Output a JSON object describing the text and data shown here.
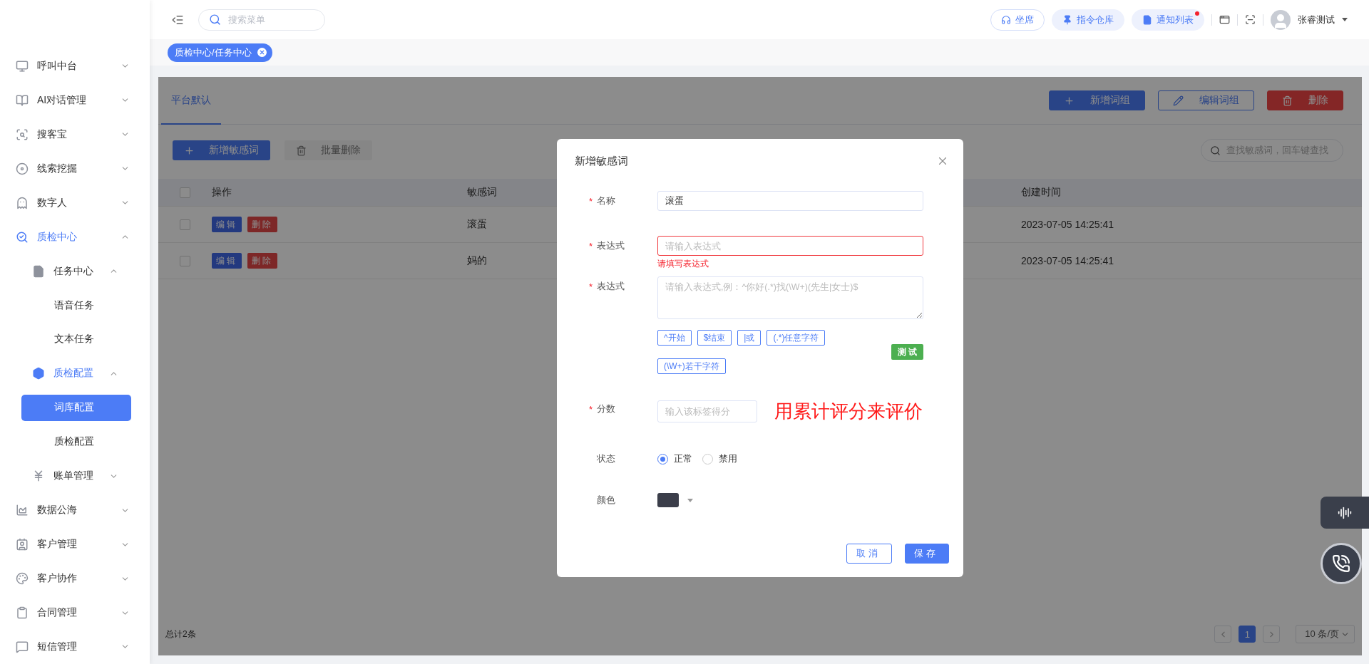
{
  "sidebar": {
    "items": [
      {
        "label": "呼叫中台",
        "expanded": false
      },
      {
        "label": "AI对话管理",
        "expanded": false
      },
      {
        "label": "搜客宝",
        "expanded": false
      },
      {
        "label": "线索挖掘",
        "expanded": false
      },
      {
        "label": "数字人",
        "expanded": false
      },
      {
        "label": "质检中心",
        "expanded": true,
        "children": [
          {
            "label": "任务中心",
            "expanded": true,
            "children": [
              {
                "label": "语音任务",
                "selected": false
              },
              {
                "label": "文本任务",
                "selected": false
              }
            ]
          },
          {
            "label": "质检配置",
            "expanded": true,
            "children": [
              {
                "label": "词库配置",
                "selected": true
              },
              {
                "label": "质检配置",
                "selected": false
              }
            ]
          },
          {
            "label": "账单管理",
            "expanded": false
          }
        ]
      },
      {
        "label": "数据公海",
        "expanded": false
      },
      {
        "label": "客户管理",
        "expanded": false
      },
      {
        "label": "客户协作",
        "expanded": false
      },
      {
        "label": "合同管理",
        "expanded": false
      },
      {
        "label": "短信管理",
        "expanded": false
      }
    ]
  },
  "header": {
    "search": {
      "placeholder": "搜索菜单"
    },
    "buttons": [
      {
        "label": "坐席",
        "kind": "outline",
        "unread": false
      },
      {
        "label": "指令仓库",
        "kind": "soft",
        "unread": false
      },
      {
        "label": "通知列表",
        "kind": "soft",
        "unread": true
      }
    ],
    "user": {
      "name": "张睿测试"
    }
  },
  "tags": [
    {
      "label": "质检中心/任务中心",
      "selected": true
    }
  ],
  "page": {
    "tabs": [
      {
        "label": "平台默认",
        "selected": true
      }
    ],
    "actions": [
      {
        "label": "新增词组",
        "kind": "primary"
      },
      {
        "label": "编辑词组",
        "kind": "outline"
      },
      {
        "label": "删除",
        "kind": "danger"
      }
    ],
    "toolbar": [
      {
        "label": "新增敏感词",
        "disabled": false
      },
      {
        "label": "批量删除",
        "disabled": true
      }
    ],
    "search": {
      "placeholder": "查找敏感词，回车键查找"
    },
    "table": {
      "all_checked": false,
      "columns": [
        "操作",
        "敏感词",
        "创建时间"
      ],
      "rows": [
        {
          "checked": false,
          "actions": [
            {
              "label": "编辑",
              "kind": "edit"
            },
            {
              "label": "删除",
              "kind": "delete"
            }
          ],
          "word": "滚蛋",
          "created": "2023-07-05 14:25:41"
        },
        {
          "checked": false,
          "actions": [
            {
              "label": "编辑",
              "kind": "edit"
            },
            {
              "label": "删除",
              "kind": "delete"
            }
          ],
          "word": "妈的",
          "created": "2023-07-05 14:25:41"
        }
      ]
    },
    "footer": {
      "total": "总计2条",
      "pages": [
        {
          "label": "1",
          "selected": true
        }
      ],
      "page_size": "10 条/页"
    }
  },
  "dialog": {
    "title": "新增敏感词",
    "required_mark": "*",
    "fields": [
      {
        "kind": "text",
        "label": "名称",
        "required": true,
        "value": "滚蛋",
        "invalid": false
      },
      {
        "kind": "text",
        "label": "表达式",
        "required": true,
        "placeholder": "请输入表达式",
        "invalid": true,
        "error": "请填写表达式"
      },
      {
        "kind": "textarea",
        "label": "表达式",
        "required": true,
        "placeholder": "请输入表达式,例：^你好(.*)找(\\W+)(先生|女士)$",
        "snippets": [
          "^开始",
          "$结束",
          "|或",
          "(.*)任意字符",
          "(\\W+)若干字符"
        ],
        "test_button": "测试"
      },
      {
        "kind": "score",
        "label": "分数",
        "required": true,
        "placeholder": "输入该标签得分",
        "annotation": "用累计评分来评价"
      },
      {
        "kind": "radio",
        "label": "状态",
        "required": false,
        "options": [
          {
            "label": "正常",
            "selected": true
          },
          {
            "label": "禁用",
            "selected": false
          }
        ]
      },
      {
        "kind": "color",
        "label": "颜色",
        "required": false,
        "color": "#3b3e4a"
      }
    ],
    "buttons": [
      {
        "label": "取消",
        "kind": "secondary"
      },
      {
        "label": "保存",
        "kind": "primary"
      }
    ]
  }
}
